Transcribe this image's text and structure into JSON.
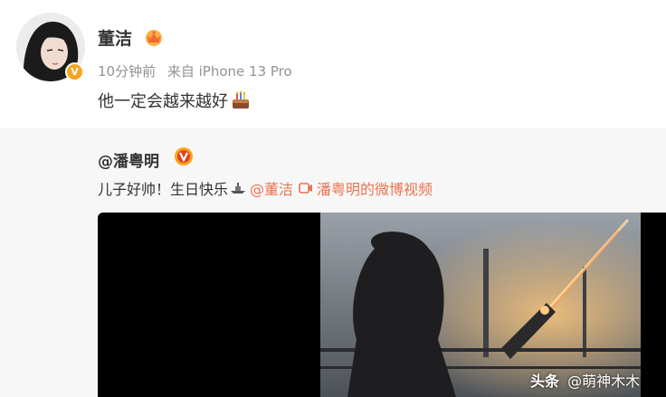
{
  "post": {
    "author": "董洁",
    "time": "10分钟前",
    "source": "来自 iPhone 13 Pro",
    "text": "他一定会越来越好",
    "verify_badge": "V"
  },
  "repost": {
    "author": "@潘粤明",
    "text": "儿子好帅！生日快乐",
    "mention": "@董洁",
    "video_link": "潘粤明的微博视频"
  },
  "watermark": {
    "brand": "头条",
    "handle": "@萌神木木"
  },
  "icons": {
    "vip": "crown-icon",
    "cake": "birthday-cake-icon",
    "boat": "boat-icon",
    "video": "video-camera-icon"
  },
  "colors": {
    "link": "#eb7350",
    "verify": "#f7a41d",
    "meta": "#939393",
    "repost_bg": "#f7f7f7"
  }
}
